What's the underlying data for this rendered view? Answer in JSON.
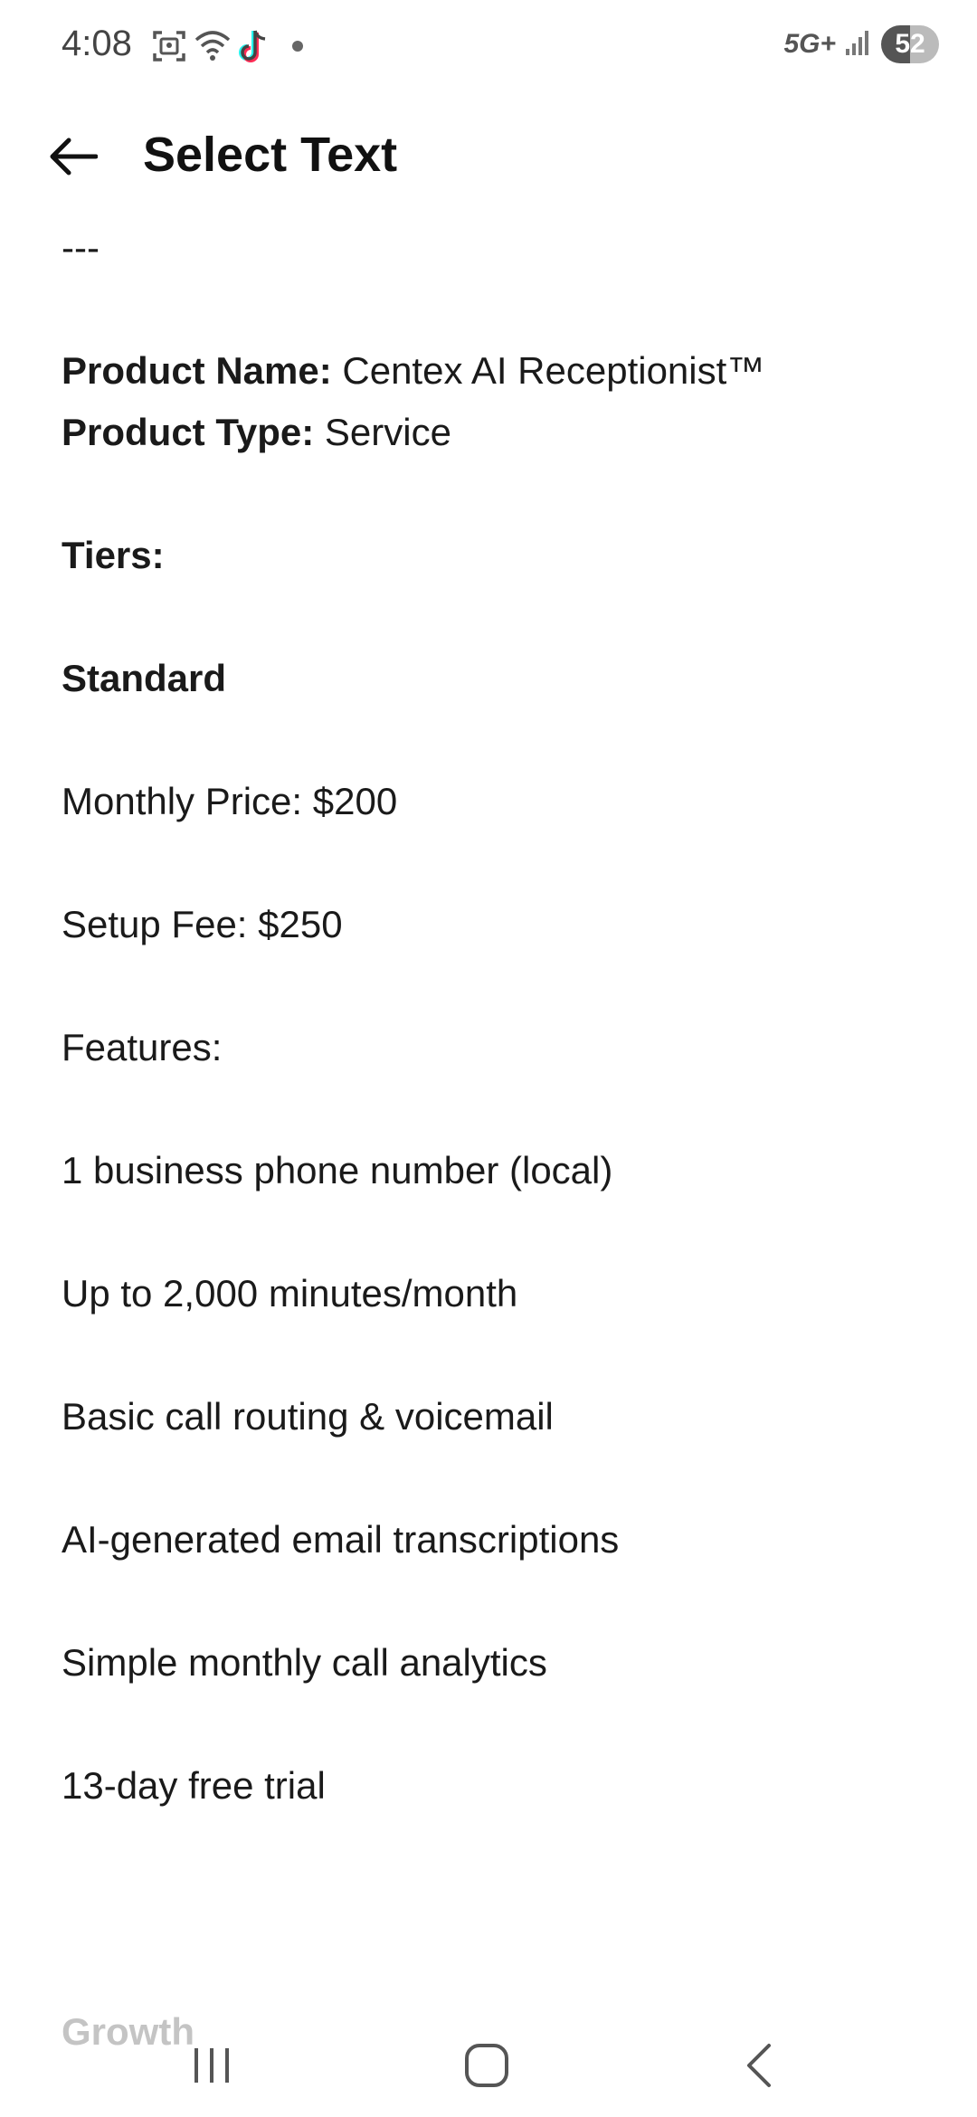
{
  "status_bar": {
    "time": "4:08",
    "network": "5G+",
    "battery": "52",
    "icons": [
      "screenshot-icon",
      "wifi-icon",
      "tiktok-icon",
      "dot-icon",
      "signal-icon",
      "battery-icon"
    ]
  },
  "app_bar": {
    "title": "Select Text",
    "back_icon": "arrow-left-icon"
  },
  "content": {
    "separator": "---",
    "product_name_label": "Product Name:",
    "product_name_value": " Centex AI Receptionist™",
    "product_type_label": "Product Type:",
    "product_type_value": " Service",
    "tiers_heading": "Tiers:",
    "tier_name": "Standard",
    "monthly_price": "Monthly Price: $200",
    "setup_fee": "Setup Fee: $250",
    "features_heading": "Features:",
    "features": [
      "1 business phone number (local)",
      "Up to 2,000 minutes/month",
      "Basic call routing & voicemail",
      "AI-generated email transcriptions",
      "Simple monthly call analytics",
      "13-day free trial"
    ],
    "next_tier": "Growth"
  },
  "nav_bar": {
    "icons": [
      "recents-icon",
      "home-icon",
      "back-icon"
    ]
  }
}
